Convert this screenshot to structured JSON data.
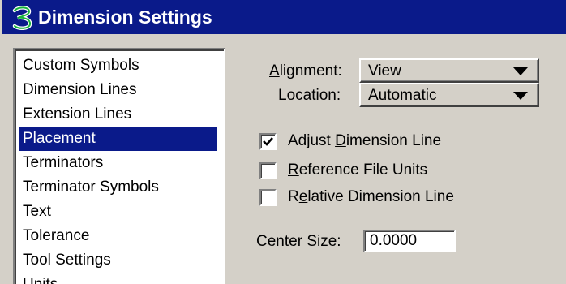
{
  "window": {
    "title": "Dimension Settings",
    "icon": "dimension-app-icon"
  },
  "categories": {
    "items": [
      {
        "label": "Custom Symbols",
        "selected": false
      },
      {
        "label": "Dimension Lines",
        "selected": false
      },
      {
        "label": "Extension Lines",
        "selected": false
      },
      {
        "label": "Placement",
        "selected": true
      },
      {
        "label": "Terminators",
        "selected": false
      },
      {
        "label": "Terminator Symbols",
        "selected": false
      },
      {
        "label": "Text",
        "selected": false
      },
      {
        "label": "Tolerance",
        "selected": false
      },
      {
        "label": "Tool Settings",
        "selected": false
      },
      {
        "label": "Units",
        "selected": false
      }
    ]
  },
  "placement": {
    "alignment": {
      "label_mnemonic": "A",
      "label_rest": "lignment:",
      "value": "View"
    },
    "location": {
      "label_mnemonic": "L",
      "label_rest": "ocation:",
      "value": "Automatic"
    },
    "adjust_dimension_line": {
      "label_before": "Adjust ",
      "label_mnemonic": "D",
      "label_after": "imension Line",
      "checked": true
    },
    "reference_file_units": {
      "label_before": "",
      "label_mnemonic": "R",
      "label_after": "eference File Units",
      "checked": false
    },
    "relative_dimension_line": {
      "label_before": "R",
      "label_mnemonic": "e",
      "label_after": "lative Dimension Line",
      "checked": false
    },
    "center_size": {
      "label_mnemonic": "C",
      "label_rest": "enter Size:",
      "value": "0.0000"
    }
  },
  "colors": {
    "title_bar": "#0a1a8a",
    "selection": "#0a1a8a",
    "dialog_face": "#d4d0c8"
  }
}
